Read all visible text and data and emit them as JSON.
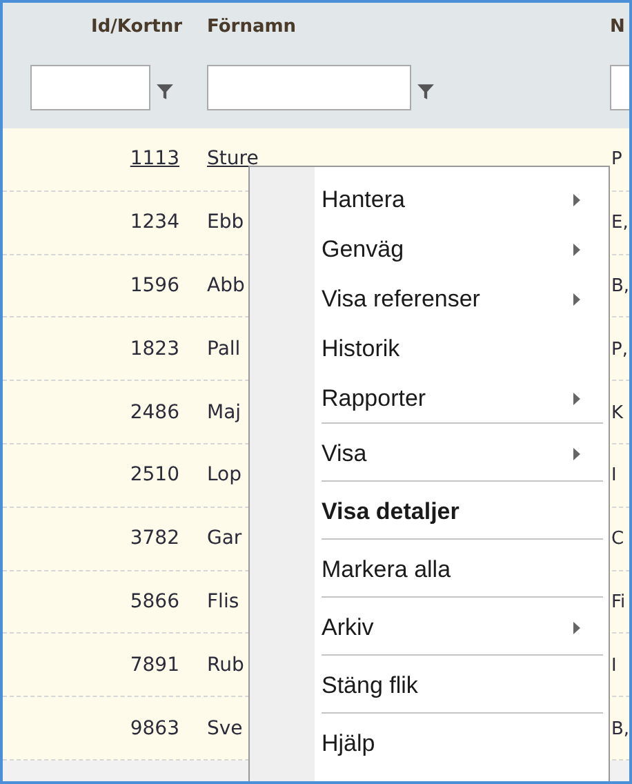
{
  "columns": [
    {
      "title": "Id/Kortnr"
    },
    {
      "title": "Förnamn"
    },
    {
      "title": "N"
    }
  ],
  "rows": [
    {
      "id": "1113",
      "first_name": "Sture",
      "column_3": "P",
      "current": true
    },
    {
      "id": "1234",
      "first_name": "Ebb",
      "column_3": "E,",
      "current": false
    },
    {
      "id": "1596",
      "first_name": "Abb",
      "column_3": "B,",
      "current": false
    },
    {
      "id": "1823",
      "first_name": "Pall",
      "column_3": "P,",
      "current": false
    },
    {
      "id": "2486",
      "first_name": "Maj",
      "column_3": "K",
      "current": false
    },
    {
      "id": "2510",
      "first_name": "Lop",
      "column_3": "I",
      "current": false
    },
    {
      "id": "3782",
      "first_name": "Gar",
      "column_3": "C",
      "current": false
    },
    {
      "id": "5866",
      "first_name": "Flis",
      "column_3": "Fi",
      "current": false
    },
    {
      "id": "7891",
      "first_name": "Rub",
      "column_3": "I",
      "current": false
    },
    {
      "id": "9863",
      "first_name": "Sve",
      "column_3": "B,",
      "current": false
    }
  ],
  "context_menu": {
    "items": [
      {
        "label": "Hantera",
        "submenu": true,
        "default": false,
        "separator_after": false
      },
      {
        "label": "Genväg",
        "submenu": true,
        "default": false,
        "separator_after": false
      },
      {
        "label": "Visa referenser",
        "submenu": true,
        "default": false,
        "separator_after": false
      },
      {
        "label": "Historik",
        "submenu": false,
        "default": false,
        "separator_after": false
      },
      {
        "label": "Rapporter",
        "submenu": true,
        "default": false,
        "separator_after": true
      },
      {
        "label": "Visa",
        "submenu": true,
        "default": false,
        "separator_after": true
      },
      {
        "label": "Visa detaljer",
        "submenu": false,
        "default": true,
        "separator_after": true
      },
      {
        "label": "Markera alla",
        "submenu": false,
        "default": false,
        "separator_after": true
      },
      {
        "label": "Arkiv",
        "submenu": true,
        "default": false,
        "separator_after": true
      },
      {
        "label": "Stäng flik",
        "submenu": false,
        "default": false,
        "separator_after": true
      },
      {
        "label": "Hjälp",
        "submenu": false,
        "default": false,
        "separator_after": false
      }
    ]
  }
}
